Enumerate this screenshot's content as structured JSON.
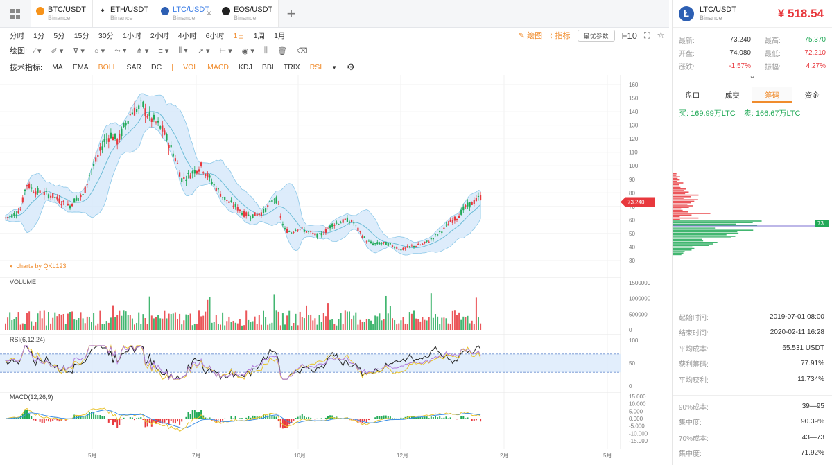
{
  "tabs": [
    {
      "symbol": "BTC/USDT",
      "exchange": "Binance",
      "coin_color": "#f7931a",
      "active": false
    },
    {
      "symbol": "ETH/USDT",
      "exchange": "Binance",
      "coin_color": "#555555",
      "active": false
    },
    {
      "symbol": "LTC/USDT",
      "exchange": "Binance",
      "coin_color": "#2d5fb3",
      "active": true
    },
    {
      "symbol": "EOS/USDT",
      "exchange": "Binance",
      "coin_color": "#222222",
      "active": false
    }
  ],
  "add_tab_label": "+",
  "close_glyph": "×",
  "timeframes": [
    "分时",
    "1分",
    "5分",
    "15分",
    "30分",
    "1小时",
    "2小时",
    "4小时",
    "6小时",
    "1日",
    "1周",
    "1月"
  ],
  "active_timeframe": "1日",
  "toolbar_right": {
    "draw": "绘图",
    "indicators": "指标",
    "preferences": "最优参数",
    "f10": "F10"
  },
  "drawing_label": "绘图:",
  "indicator_label": "技术指标:",
  "indicators": [
    "MA",
    "EMA",
    "BOLL",
    "SAR",
    "DC",
    "VOL",
    "MACD",
    "KDJ",
    "BBI",
    "TRIX",
    "RSI"
  ],
  "indicators_on": [
    "BOLL",
    "VOL",
    "MACD",
    "RSI"
  ],
  "watermark": "charts by QKL123",
  "pane_labels": {
    "volume": "VOLUME",
    "rsi": "RSI(6,12,24)",
    "macd": "MACD(12,26,9)"
  },
  "colors": {
    "up": "#e8383d",
    "down": "#21a957",
    "accent": "#f08c2d",
    "boll_fill": "#d4e7fa",
    "boll_line": "#8cc8e8"
  },
  "chart_data": {
    "type": "candlestick",
    "symbol": "LTC/USDT",
    "current_price": 73.24,
    "price_axis": {
      "ticks": [
        30,
        40,
        50,
        60,
        70,
        80,
        90,
        100,
        110,
        120,
        130,
        140,
        150,
        160
      ],
      "range": [
        30,
        160
      ]
    },
    "volume_axis": {
      "ticks": [
        "1500000",
        "1000000",
        "500000",
        "0"
      ]
    },
    "rsi_axis": {
      "ticks": [
        "100",
        "50",
        "0"
      ]
    },
    "macd_axis": {
      "ticks": [
        "15.000",
        "10.000",
        "5.000",
        "0.000",
        "-5.000",
        "-10.000",
        "-15.000"
      ]
    },
    "x_labels": [
      "5月",
      "7月",
      "10月",
      "12月",
      "2月",
      "5月"
    ],
    "close_trajectory": [
      [
        0,
        60
      ],
      [
        10,
        62
      ],
      [
        20,
        64
      ],
      [
        30,
        68
      ],
      [
        38,
        87
      ],
      [
        48,
        82
      ],
      [
        60,
        80
      ],
      [
        75,
        78
      ],
      [
        90,
        73
      ],
      [
        100,
        70
      ],
      [
        110,
        76
      ],
      [
        120,
        78
      ],
      [
        130,
        95
      ],
      [
        140,
        105
      ],
      [
        150,
        118
      ],
      [
        160,
        123
      ],
      [
        170,
        118
      ],
      [
        180,
        130
      ],
      [
        190,
        140
      ],
      [
        200,
        142
      ],
      [
        205,
        146
      ],
      [
        210,
        140
      ],
      [
        215,
        136
      ],
      [
        225,
        132
      ],
      [
        235,
        126
      ],
      [
        245,
        115
      ],
      [
        255,
        103
      ],
      [
        262,
        90
      ],
      [
        270,
        92
      ],
      [
        280,
        96
      ],
      [
        290,
        100
      ],
      [
        300,
        92
      ],
      [
        310,
        85
      ],
      [
        320,
        78
      ],
      [
        330,
        73
      ],
      [
        340,
        70
      ],
      [
        350,
        65
      ],
      [
        360,
        63
      ],
      [
        370,
        64
      ],
      [
        380,
        66
      ],
      [
        390,
        72
      ],
      [
        395,
        76
      ],
      [
        400,
        74
      ],
      [
        405,
        62
      ],
      [
        410,
        53
      ],
      [
        420,
        51
      ],
      [
        430,
        54
      ],
      [
        440,
        52
      ],
      [
        450,
        50
      ],
      [
        460,
        48
      ],
      [
        470,
        52
      ],
      [
        480,
        57
      ],
      [
        490,
        58
      ],
      [
        500,
        60
      ],
      [
        510,
        58
      ],
      [
        520,
        50
      ],
      [
        530,
        44
      ],
      [
        540,
        42
      ],
      [
        550,
        43
      ],
      [
        560,
        42
      ],
      [
        570,
        40
      ],
      [
        580,
        38
      ],
      [
        590,
        40
      ],
      [
        600,
        41
      ],
      [
        610,
        42
      ],
      [
        620,
        45
      ],
      [
        630,
        49
      ],
      [
        640,
        53
      ],
      [
        650,
        59
      ],
      [
        660,
        62
      ],
      [
        670,
        69
      ],
      [
        680,
        72
      ],
      [
        690,
        76
      ],
      [
        695,
        78
      ]
    ]
  },
  "panel": {
    "symbol": "LTC/USDT",
    "exchange": "Binance",
    "logo_letter": "Ł",
    "price": "¥ 518.54",
    "stats": [
      {
        "k": "最新:",
        "v": "73.240",
        "k2": "最高:",
        "v2": "75.370",
        "v2_color": "green"
      },
      {
        "k": "开盘:",
        "v": "74.080",
        "k2": "最低:",
        "v2": "72.210",
        "v2_color": "red"
      },
      {
        "k": "涨跌:",
        "v": "-1.57%",
        "v_color": "red",
        "k2": "振幅:",
        "v2": "4.27%",
        "v2_color": "red"
      }
    ],
    "expand_glyph": "⌄",
    "tabs": [
      "盘口",
      "成交",
      "筹码",
      "资金"
    ],
    "active_tab": "筹码",
    "buy": "买: 169.99万LTC",
    "sell": "卖: 166.67万LTC",
    "chip_price_label": "73",
    "info_top": [
      {
        "k": "起始时间:",
        "v": "2019-07-01 08:00"
      },
      {
        "k": "结束时间:",
        "v": "2020-02-11 16:28"
      },
      {
        "k": "平均成本:",
        "v": "65.531 USDT",
        "color": "green"
      },
      {
        "k": "获利筹码:",
        "v": "77.91%"
      },
      {
        "k": "平均获利:",
        "v": "11.734%",
        "color": "green"
      }
    ],
    "info_bottom": [
      {
        "k": "90%成本:",
        "v": "39—95"
      },
      {
        "k": "集中度:",
        "v": "90.39%"
      },
      {
        "k": "70%成本:",
        "v": "43—73"
      },
      {
        "k": "集中度:",
        "v": "71.92%"
      }
    ]
  }
}
